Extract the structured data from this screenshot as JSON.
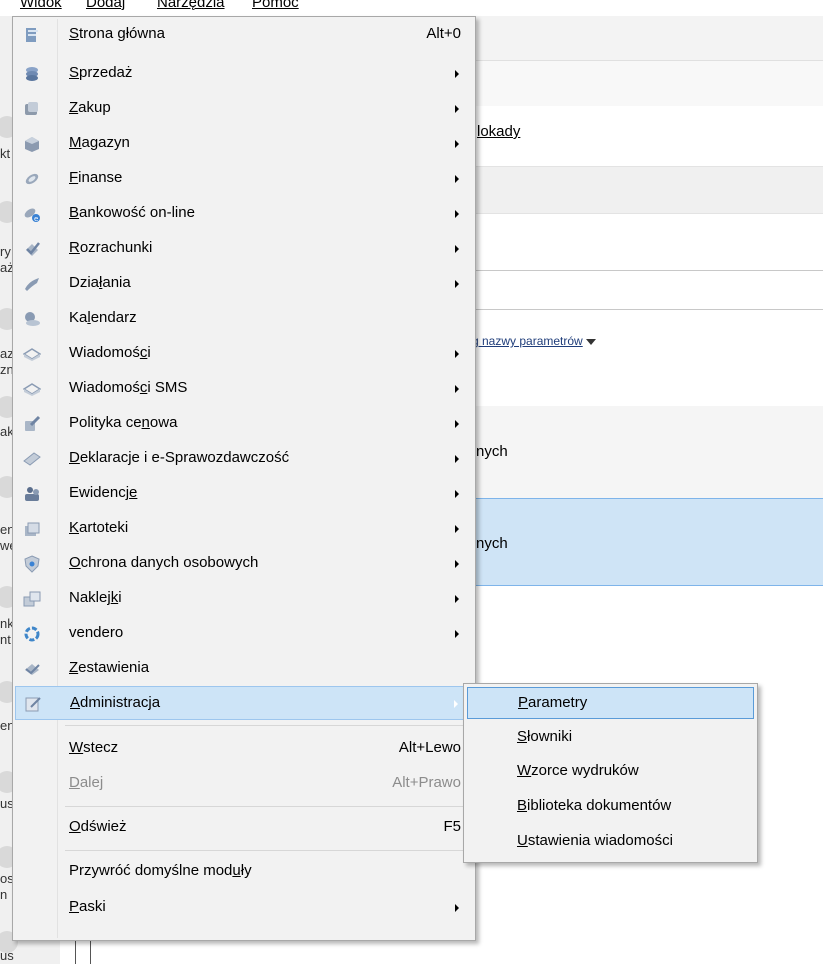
{
  "menubar": {
    "items": [
      {
        "label": "Widok"
      },
      {
        "label": "Dodaj"
      },
      {
        "label": "Narzędzia"
      },
      {
        "label": "Pomoc"
      }
    ]
  },
  "background": {
    "link_fragment": "lokady",
    "filter_fragment": "g nazwy parametrów",
    "row1_fragment": "nych",
    "row2_fragment": "nych",
    "sidebar_fragments": [
      "kt",
      "ry",
      "aż",
      "az",
      "zn",
      "ak",
      "en",
      "we",
      "nk",
      "nt",
      "en",
      "us",
      "os",
      "n",
      "us"
    ]
  },
  "menu": {
    "items": [
      {
        "pre": "",
        "u": "S",
        "post": "trona główna",
        "shortcut": "Alt+0",
        "icon": "home-icon",
        "submenu": false
      },
      {
        "pre": "",
        "u": "S",
        "post": "przedaż",
        "shortcut": "",
        "icon": "sales-icon",
        "submenu": true
      },
      {
        "pre": "",
        "u": "Z",
        "post": "akup",
        "shortcut": "",
        "icon": "purchase-icon",
        "submenu": true
      },
      {
        "pre": "",
        "u": "M",
        "post": "agazyn",
        "shortcut": "",
        "icon": "warehouse-icon",
        "submenu": true
      },
      {
        "pre": "",
        "u": "F",
        "post": "inanse",
        "shortcut": "",
        "icon": "finance-icon",
        "submenu": true
      },
      {
        "pre": "",
        "u": "B",
        "post": "ankowość on-line",
        "shortcut": "",
        "icon": "online-banking-icon",
        "submenu": true
      },
      {
        "pre": "",
        "u": "R",
        "post": "ozrachunki",
        "shortcut": "",
        "icon": "settlements-icon",
        "submenu": true
      },
      {
        "pre": "Dzia",
        "u": "ł",
        "post": "ania",
        "shortcut": "",
        "icon": "activities-icon",
        "submenu": true
      },
      {
        "pre": "Ka",
        "u": "l",
        "post": "endarz",
        "shortcut": "",
        "icon": "calendar-icon",
        "submenu": false
      },
      {
        "pre": "Wiadomoś",
        "u": "c",
        "post": "i",
        "shortcut": "",
        "icon": "messages-icon",
        "submenu": true
      },
      {
        "pre": "Wiadomoś",
        "u": "c",
        "post": "i SMS",
        "shortcut": "",
        "icon": "sms-icon",
        "submenu": true
      },
      {
        "pre": "Polityka ce",
        "u": "n",
        "post": "owa",
        "shortcut": "",
        "icon": "pricing-icon",
        "submenu": true
      },
      {
        "pre": "",
        "u": "D",
        "post": "eklaracje i e-Sprawozdawczość",
        "shortcut": "",
        "icon": "declarations-icon",
        "submenu": true
      },
      {
        "pre": "Ewidencj",
        "u": "e",
        "post": "",
        "shortcut": "",
        "icon": "records-icon",
        "submenu": true
      },
      {
        "pre": "",
        "u": "K",
        "post": "artoteki",
        "shortcut": "",
        "icon": "card-index-icon",
        "submenu": true
      },
      {
        "pre": "",
        "u": "O",
        "post": "chrona danych osobowych",
        "shortcut": "",
        "icon": "data-protection-icon",
        "submenu": true
      },
      {
        "pre": "Naklej",
        "u": "k",
        "post": "i",
        "shortcut": "",
        "icon": "labels-icon",
        "submenu": true
      },
      {
        "pre": "vendero",
        "u": "",
        "post": "",
        "shortcut": "",
        "icon": "vendero-icon",
        "submenu": true
      },
      {
        "pre": "",
        "u": "Z",
        "post": "estawienia",
        "shortcut": "",
        "icon": "reports-icon",
        "submenu": false
      },
      {
        "pre": "",
        "u": "A",
        "post": "dministracja",
        "shortcut": "",
        "icon": "administration-icon",
        "submenu": true
      },
      {
        "pre": "",
        "u": "W",
        "post": "stecz",
        "shortcut": "Alt+Lewo",
        "icon": "",
        "submenu": false
      },
      {
        "pre": "",
        "u": "D",
        "post": "alej",
        "shortcut": "Alt+Prawo",
        "icon": "",
        "submenu": false
      },
      {
        "pre": "",
        "u": "O",
        "post": "dśwież",
        "shortcut": "F5",
        "icon": "",
        "submenu": false
      },
      {
        "pre": "Przywróć domyślne mod",
        "u": "u",
        "post": "ły",
        "shortcut": "",
        "icon": "",
        "submenu": false
      },
      {
        "pre": "",
        "u": "P",
        "post": "aski",
        "shortcut": "",
        "icon": "",
        "submenu": true
      }
    ]
  },
  "submenu": {
    "items": [
      {
        "pre": "",
        "u": "P",
        "post": "arametry"
      },
      {
        "pre": "",
        "u": "S",
        "post": "łowniki"
      },
      {
        "pre": "",
        "u": "W",
        "post": "zorce wydruków"
      },
      {
        "pre": "",
        "u": "B",
        "post": "iblioteka dokumentów"
      },
      {
        "pre": "",
        "u": "U",
        "post": "stawienia wiadomości"
      }
    ]
  },
  "colors": {
    "highlight": "#cde4f7",
    "highlight_border": "#9dc6ee",
    "menu_bg": "#f2f2f2",
    "selected_row": "#cfe4f6"
  }
}
